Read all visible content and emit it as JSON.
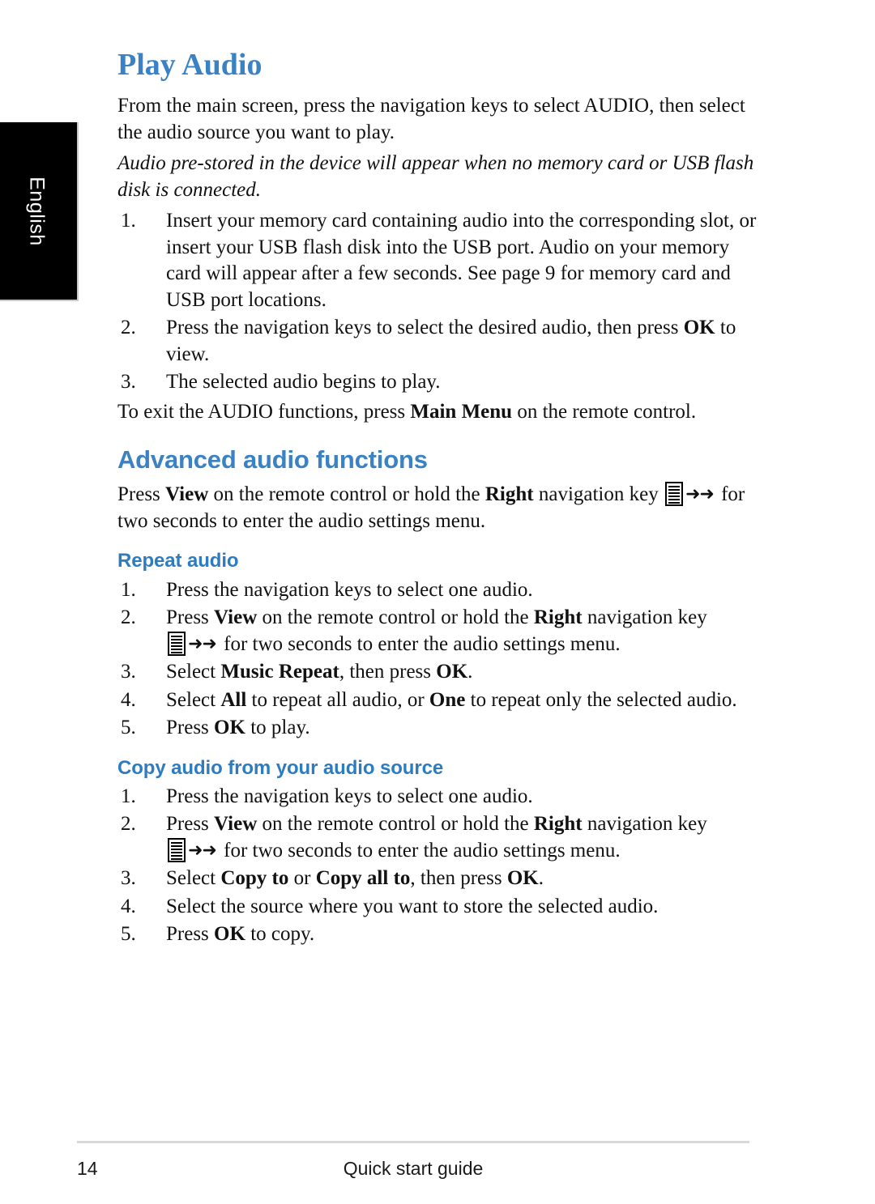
{
  "sidebar": {
    "language_tab": "English"
  },
  "page": {
    "title": "Play Audio",
    "intro": "From the main screen, press the navigation keys to select AUDIO, then select the audio source you want to play.",
    "note_italic": "Audio pre-stored in the device will appear when no memory card or USB flash disk is connected.",
    "play_audio_steps": [
      {
        "num": "1.",
        "text": "Insert your memory card containing audio into the corresponding slot, or insert your USB flash disk into the USB port. Audio on your memory card will appear after a few seconds. See page 9 for memory card and USB port locations."
      },
      {
        "num": "2.",
        "pre": "Press the navigation keys to select the desired audio, then press ",
        "bold": "OK",
        "post": " to view."
      },
      {
        "num": "3.",
        "text": "The selected audio begins to play."
      }
    ],
    "exit_line": {
      "pre": "To exit the AUDIO functions, press ",
      "bold": "Main Menu",
      "post": " on the remote control."
    }
  },
  "advanced": {
    "heading": "Advanced audio functions",
    "intro": {
      "p1": "Press ",
      "b1": "View",
      "p2": " on the remote control or hold the ",
      "b2": "Right",
      "p3": " navigation key ",
      "p4": " for two seconds to enter the audio settings menu."
    }
  },
  "repeat_audio": {
    "heading": "Repeat audio",
    "steps": [
      {
        "num": "1.",
        "text": "Press the navigation keys to select one audio."
      },
      {
        "num": "2.",
        "p1": "Press ",
        "b1": "View",
        "p2": " on the remote control or hold the ",
        "b2": "Right",
        "p3": " navigation key ",
        "p4": " for two seconds to enter the audio settings menu."
      },
      {
        "num": "3.",
        "p1": "Select ",
        "b1": "Music Repeat",
        "p2": ", then press ",
        "b2": "OK",
        "p3": "."
      },
      {
        "num": "4.",
        "p1": "Select ",
        "b1": "All",
        "p2": " to repeat all audio, or ",
        "b2": "One",
        "p3": " to repeat only the selected audio."
      },
      {
        "num": "5.",
        "p1": "Press ",
        "b1": "OK",
        "p2": " to play."
      }
    ]
  },
  "copy_audio": {
    "heading": "Copy audio from your audio source",
    "steps": [
      {
        "num": "1.",
        "text": "Press the navigation keys to select one audio."
      },
      {
        "num": "2.",
        "p1": "Press ",
        "b1": "View",
        "p2": " on the remote control or hold the ",
        "b2": "Right",
        "p3": " navigation key ",
        "p4": " for two seconds to enter the audio settings menu."
      },
      {
        "num": "3.",
        "p1": "Select ",
        "b1": "Copy to",
        "p2": " or ",
        "b2": "Copy all to",
        "p3": ", then press ",
        "b3": "OK",
        "p4": "."
      },
      {
        "num": "4.",
        "text": "Select the source where you want to store the selected audio."
      },
      {
        "num": "5.",
        "p1": "Press ",
        "b1": "OK",
        "p2": " to copy."
      }
    ]
  },
  "footer": {
    "page_number": "14",
    "guide_label": "Quick start guide"
  },
  "icons": {
    "list_menu": "list-menu-icon",
    "arrows": "➜➜"
  },
  "colors": {
    "heading_blue": "#3a82c4",
    "subhead_blue": "#2e7cc0",
    "tab_black": "#000000",
    "rule_gray": "#d8d8d8"
  }
}
